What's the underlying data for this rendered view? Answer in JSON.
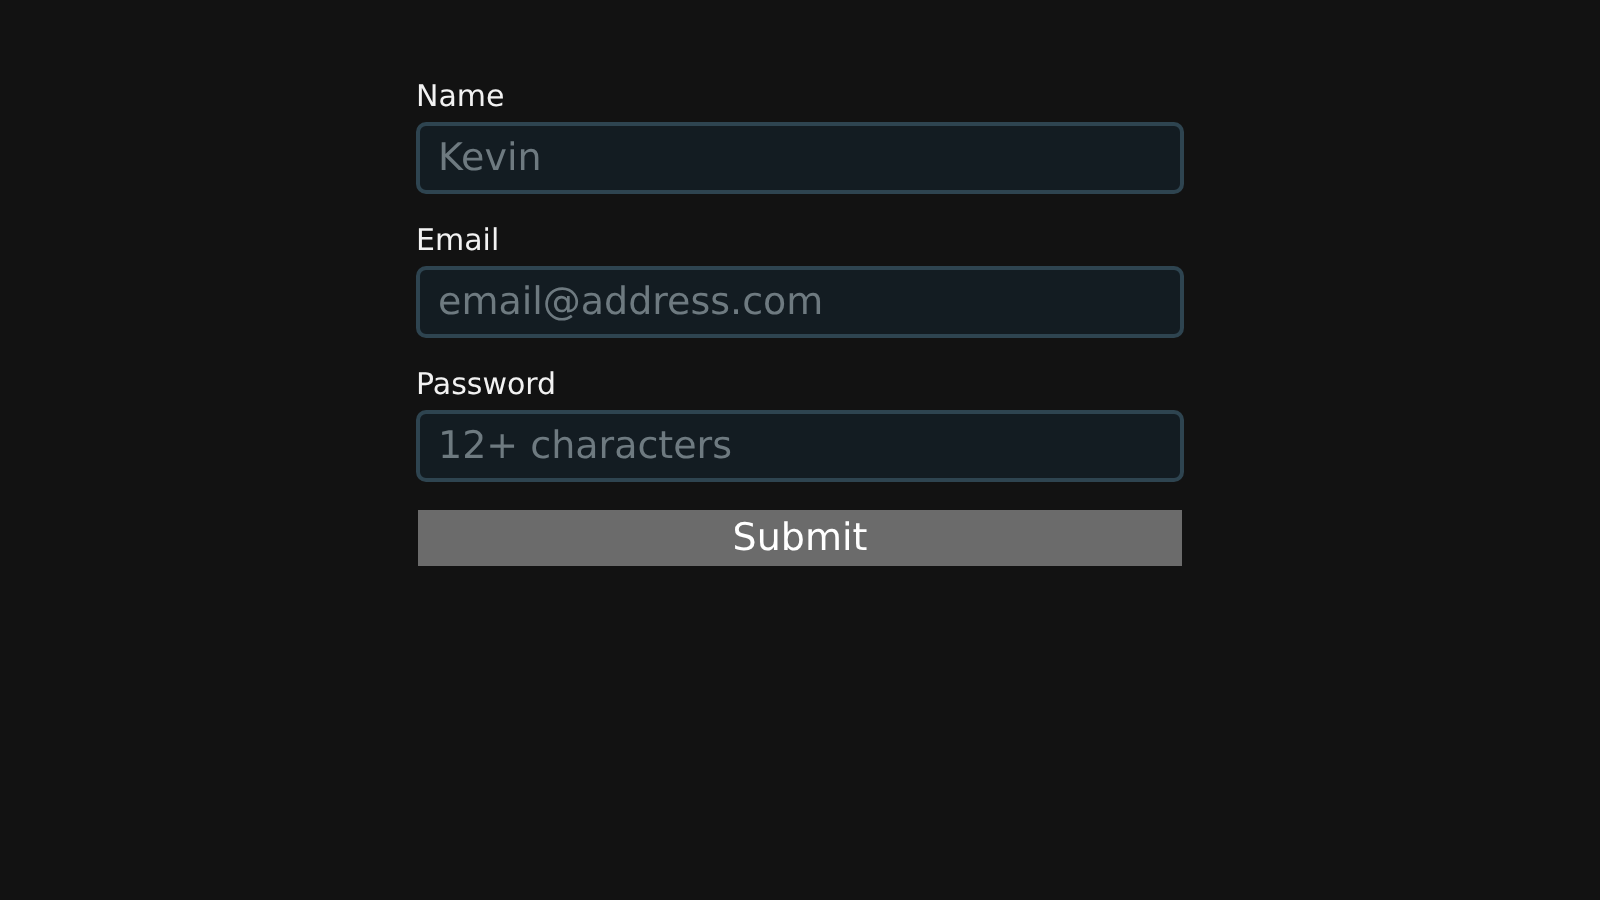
{
  "fields": [
    {
      "label": "Name",
      "placeholder": "Kevin"
    },
    {
      "label": "Email",
      "placeholder": "email@address.com"
    },
    {
      "label": "Password",
      "placeholder": "12+ characters"
    }
  ],
  "submit": {
    "label": "Submit"
  }
}
